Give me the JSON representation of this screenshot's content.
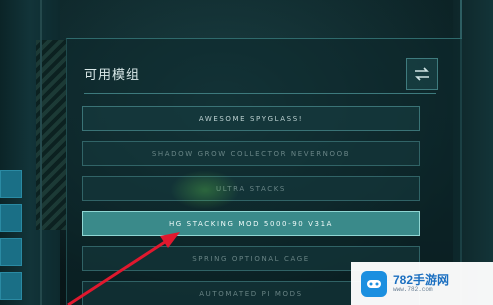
{
  "panel": {
    "title": "可用模组",
    "icon": "swap-arrows-icon"
  },
  "mods": [
    {
      "label": "AWESOME SPYGLASS!",
      "state": "normal"
    },
    {
      "label": "SHADOW  GROW  COLLECTOR  NEVERNOOB",
      "state": "dim"
    },
    {
      "label": "ULTRA  STACKS",
      "state": "dim"
    },
    {
      "label": "HG  STACKING  MOD  5000-90  V31A",
      "state": "selected"
    },
    {
      "label": "SPRING  OPTIONAL  CAGE",
      "state": "dim"
    },
    {
      "label": "AUTOMATED  PI  MODS",
      "state": "dim"
    }
  ],
  "watermark": {
    "brand": "782手游网",
    "url": "www.782.com"
  },
  "colors": {
    "accent": "#3a8a8a",
    "selected_border": "#8fd6d3",
    "annotation": "#e0182e",
    "watermark_blue": "#1b8fe0"
  }
}
